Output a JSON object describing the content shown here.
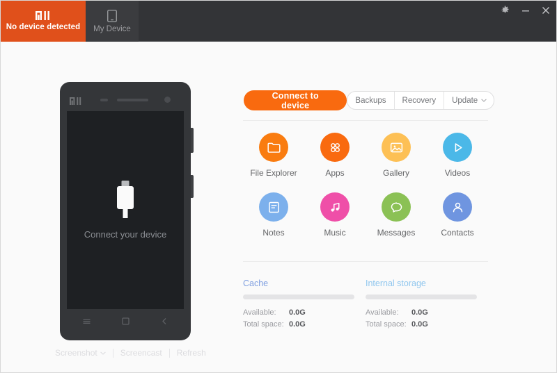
{
  "window": {
    "controls": [
      {
        "name": "settings",
        "icon": "gear-icon",
        "label": "Settings"
      },
      {
        "name": "minimize",
        "icon": "minimize-icon",
        "label": "Minimize"
      },
      {
        "name": "close",
        "icon": "close-icon",
        "label": "Close"
      }
    ]
  },
  "tabs": [
    {
      "id": "status",
      "label": "No device detected",
      "icon": "mi-logo-icon",
      "active": true,
      "bg": "#e0501b"
    },
    {
      "id": "device",
      "label": "My Device",
      "icon": "phone-icon",
      "active": false,
      "bg": "#3b3c3f"
    }
  ],
  "phone": {
    "brand": "MI",
    "screen_hint": "Connect your device",
    "usb_icon": "usb-plug-icon",
    "nav": [
      {
        "name": "menu",
        "icon": "menu-icon"
      },
      {
        "name": "home",
        "icon": "home-icon"
      },
      {
        "name": "back",
        "icon": "back-icon"
      }
    ]
  },
  "bottom_tools": [
    {
      "id": "screenshot",
      "label": "Screenshot",
      "has_caret": true
    },
    {
      "id": "screencast",
      "label": "Screencast",
      "has_caret": false
    },
    {
      "id": "refresh",
      "label": "Refresh",
      "has_caret": false
    }
  ],
  "actions": {
    "connect_label": "Connect to device",
    "connect_color": "#f96a0f",
    "segmented": [
      {
        "id": "backups",
        "label": "Backups",
        "has_caret": false
      },
      {
        "id": "recovery",
        "label": "Recovery",
        "has_caret": false
      },
      {
        "id": "update",
        "label": "Update",
        "has_caret": true
      }
    ]
  },
  "grid": [
    {
      "id": "file-explorer",
      "label": "File Explorer",
      "icon": "folder-icon",
      "color": "#f97c10"
    },
    {
      "id": "apps",
      "label": "Apps",
      "icon": "apps-icon",
      "color": "#f96a0f"
    },
    {
      "id": "gallery",
      "label": "Gallery",
      "icon": "gallery-icon",
      "color": "#fdc055"
    },
    {
      "id": "videos",
      "label": "Videos",
      "icon": "play-icon",
      "color": "#4bb8e8"
    },
    {
      "id": "notes",
      "label": "Notes",
      "icon": "notes-icon",
      "color": "#7cb0ec"
    },
    {
      "id": "music",
      "label": "Music",
      "icon": "music-icon",
      "color": "#ef4fa8"
    },
    {
      "id": "messages",
      "label": "Messages",
      "icon": "message-icon",
      "color": "#8bc155"
    },
    {
      "id": "contacts",
      "label": "Contacts",
      "icon": "contacts-icon",
      "color": "#6f95e0"
    }
  ],
  "storage": [
    {
      "id": "cache",
      "title": "Cache",
      "title_color": "#7f9fe0",
      "available_label": "Available:",
      "available_value": "0.0G",
      "total_label": "Total space:",
      "total_value": "0.0G",
      "fill_percent": 0
    },
    {
      "id": "internal-storage",
      "title": "Internal storage",
      "title_color": "#8fc6ee",
      "available_label": "Available:",
      "available_value": "0.0G",
      "total_label": "Total space:",
      "total_value": "0.0G",
      "fill_percent": 0
    }
  ]
}
